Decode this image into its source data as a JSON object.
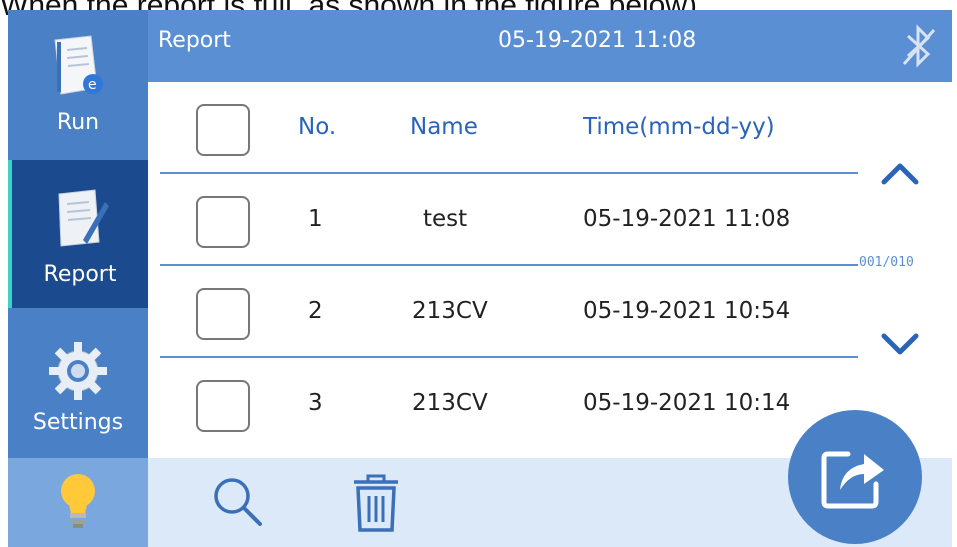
{
  "caption": "When the report is full, as shown in the figure below)",
  "sidebar": {
    "items": [
      {
        "label": "Run"
      },
      {
        "label": "Report"
      },
      {
        "label": "Settings"
      }
    ]
  },
  "header": {
    "title": "Report",
    "datetime": "05-19-2021 11:08"
  },
  "table": {
    "columns": [
      "No.",
      "Name",
      "Time(mm-dd-yy)"
    ],
    "rows": [
      {
        "no": "1",
        "name": "test",
        "time": "05-19-2021 11:08"
      },
      {
        "no": "2",
        "name": "213CV",
        "time": "05-19-2021 10:54"
      },
      {
        "no": "3",
        "name": "213CV",
        "time": "05-19-2021 10:14"
      }
    ]
  },
  "pager": {
    "text": "001/010"
  },
  "colors": {
    "sidebar": "#4a80c6",
    "sidebar_active": "#1c4a8e",
    "header": "#5b8fd3",
    "toolbar": "#dce9f9",
    "accent": "#2a64b8"
  },
  "icons": [
    "run-doc-icon",
    "report-doc-icon",
    "gear-icon",
    "lightbulb-icon",
    "bluetooth-icon",
    "chevron-up-icon",
    "chevron-down-icon",
    "search-icon",
    "trash-icon",
    "export-icon"
  ]
}
